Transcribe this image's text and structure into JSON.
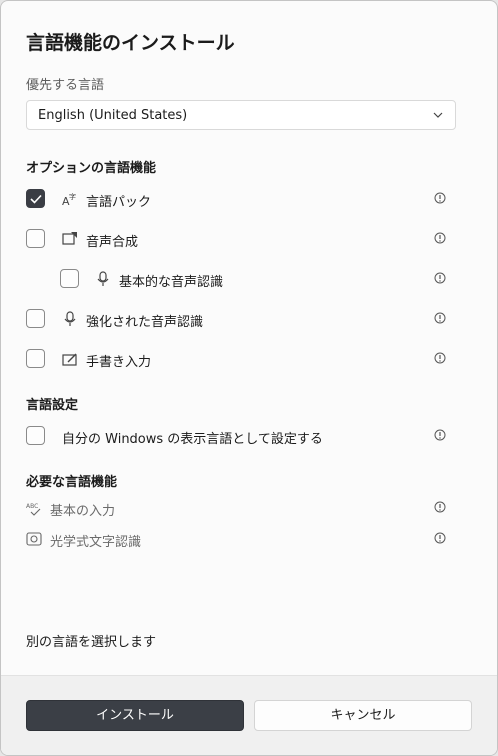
{
  "dialog": {
    "title": "言語機能のインストール",
    "preferred_label": "優先する言語",
    "preferred_value": "English (United States)"
  },
  "optional": {
    "heading": "オプションの言語機能",
    "items": [
      {
        "label": "言語パック",
        "checked": true,
        "icon": "language-pack-icon"
      },
      {
        "label": "音声合成",
        "checked": false,
        "icon": "text-to-speech-icon"
      },
      {
        "label": "基本的な音声認識",
        "checked": false,
        "icon": "microphone-icon"
      },
      {
        "label": "強化された音声認識",
        "checked": false,
        "icon": "microphone-icon"
      },
      {
        "label": "手書き入力",
        "checked": false,
        "icon": "handwriting-icon"
      }
    ]
  },
  "settings": {
    "heading": "言語設定",
    "display_label": "自分の Windows の表示言語として設定する",
    "display_checked": false
  },
  "required": {
    "heading": "必要な言語機能",
    "items": [
      {
        "label": "基本の入力",
        "icon": "basic-typing-icon"
      },
      {
        "label": "光学式文字認識",
        "icon": "ocr-icon"
      }
    ]
  },
  "choose_other": "別の言語を選択します",
  "buttons": {
    "install": "インストール",
    "cancel": "キャンセル"
  },
  "colors": {
    "primary": "#3b3f46",
    "checkbox_on": "#3a3d44"
  }
}
